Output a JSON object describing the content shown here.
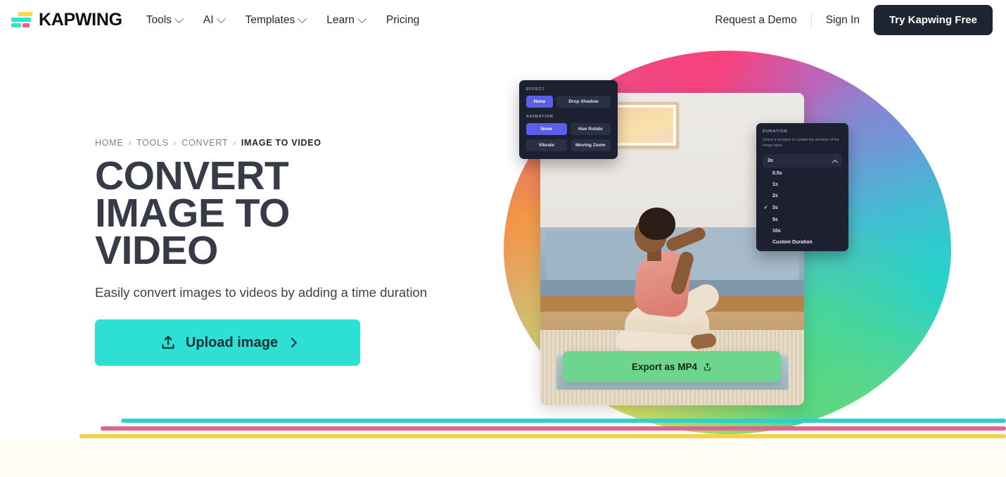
{
  "brand": {
    "name": "KAPWING",
    "logo_icon": "kapwing-bars-logo"
  },
  "nav": {
    "links": [
      {
        "label": "Tools",
        "has_dropdown": true
      },
      {
        "label": "AI",
        "has_dropdown": true
      },
      {
        "label": "Templates",
        "has_dropdown": true
      },
      {
        "label": "Learn",
        "has_dropdown": true
      },
      {
        "label": "Pricing",
        "has_dropdown": false
      }
    ],
    "request_demo": "Request a Demo",
    "sign_in": "Sign In",
    "cta": "Try Kapwing Free"
  },
  "hero": {
    "breadcrumb": [
      {
        "label": "HOME",
        "active": false
      },
      {
        "label": "TOOLS",
        "active": false
      },
      {
        "label": "CONVERT",
        "active": false
      },
      {
        "label": "IMAGE TO VIDEO",
        "active": true
      }
    ],
    "breadcrumb_separator": "›",
    "title": "Convert image to video",
    "subtitle": "Easily convert images to videos by adding a time duration",
    "upload_button": {
      "label": "Upload image",
      "icon": "upload-icon",
      "arrow": "chevron-right-icon"
    }
  },
  "editor_preview": {
    "effect_panel": {
      "section_label": "EFFECT",
      "effect_options": [
        {
          "label": "None",
          "selected": true
        },
        {
          "label": "Drop Shadow",
          "selected": false
        }
      ],
      "animation_label": "ANIMATION",
      "animation_options": [
        {
          "label": "None",
          "selected": true
        },
        {
          "label": "Hue Rotate",
          "selected": false
        },
        {
          "label": "Vibrate",
          "selected": false
        },
        {
          "label": "Moving Zoom",
          "selected": false
        }
      ]
    },
    "duration_panel": {
      "section_label": "DURATION",
      "description": "Select a duration to update the duration of the image layer",
      "selected_value": "3s",
      "caret_icon": "chevron-up-icon",
      "options": [
        {
          "label": "0.5s",
          "checked": false
        },
        {
          "label": "1s",
          "checked": false
        },
        {
          "label": "2s",
          "checked": false
        },
        {
          "label": "3s",
          "checked": true
        },
        {
          "label": "5s",
          "checked": false
        },
        {
          "label": "10s",
          "checked": false
        },
        {
          "label": "Custom Duration",
          "checked": false
        }
      ],
      "check_glyph": "✓"
    },
    "export_button": {
      "label": "Export as MP4",
      "icon": "export-share-icon"
    }
  },
  "colors": {
    "accent_teal": "#2ee0d3",
    "nav_cta_bg": "#1d2432",
    "heading": "#373a47",
    "export_green": "#6ed58c",
    "panel_bg": "#1c2030",
    "panel_selected": "#5a5fe8",
    "rule_teal": "#2ecfcc",
    "rule_pink": "#e4628e",
    "rule_yellow": "#f5d24a"
  }
}
